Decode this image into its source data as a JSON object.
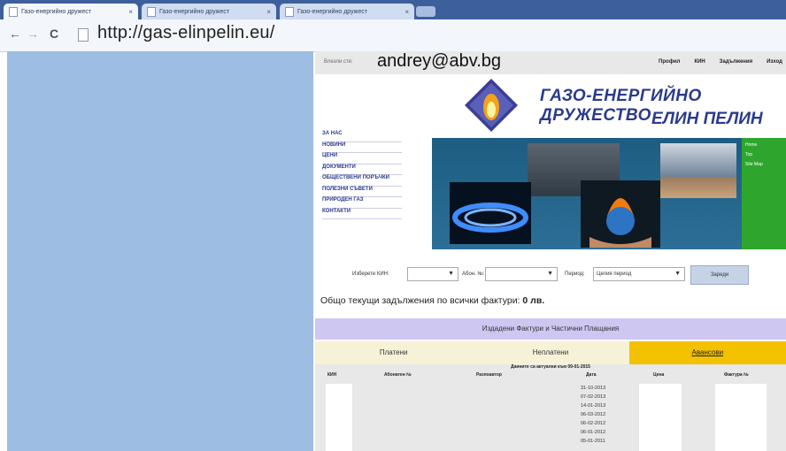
{
  "browser": {
    "tabs": [
      {
        "title": "Газо-енергийно дружест",
        "active": true
      },
      {
        "title": "Газо-енергийно дружест",
        "active": false
      },
      {
        "title": "Газо-енергийно дружест",
        "active": false
      }
    ],
    "tab_close": "×",
    "url": "http://gas-elinpelin.eu/",
    "back_icon": "←",
    "forward_icon": "→",
    "reload_icon": "C"
  },
  "userbar": {
    "label": "Влезли сте:",
    "email": "andrey@abv.bg",
    "nav": [
      "Профил",
      "КИН",
      "Задължения",
      "Изход"
    ]
  },
  "header": {
    "brand_line1": "ГАЗО-ЕНЕРГИЙНО ДРУЖЕСТВО",
    "brand_line2": "ЕЛИН ПЕЛИН"
  },
  "menu": [
    "ЗА НАС",
    "НОВИНИ",
    "ЦЕНИ",
    "ДОКУМЕНТИ",
    "ОБЩЕСТВЕНИ ПОРЪЧКИ",
    "ПОЛЕЗНИ СЪВЕТИ",
    "ПРИРОДЕН ГАЗ",
    "КОНТАКТИ"
  ],
  "side_links": [
    "Home",
    "Top",
    "Site Map"
  ],
  "filters": {
    "kin_label": "Изберете КИН:",
    "kin_value": "",
    "abon_label": "Абон. №:",
    "abon_value": "",
    "period_label": "Период:",
    "period_value": "Целия период",
    "load_button": "Зареди"
  },
  "total": {
    "text": "Общо текущи задължения по всички фактури:",
    "amount": "0 лв."
  },
  "section_title": "Издадени Фактури и Частични Плащания",
  "invoice_tabs": [
    {
      "label": "Платени",
      "active": false
    },
    {
      "label": "Неплатени",
      "active": false
    },
    {
      "label": "Авансови",
      "active": true
    }
  ],
  "table": {
    "caption": "Данните са актуални към 09-01-2015",
    "headers": [
      "КИН",
      "Абонатен №",
      "Разпоавтор",
      "Дата",
      "Цена",
      "Фактура №"
    ],
    "dates": [
      "31-10-2013",
      "07-02-2013",
      "14-01-2013",
      "06-03-2012",
      "06-02-2012",
      "06-01-2012",
      "05-01-2011"
    ]
  }
}
